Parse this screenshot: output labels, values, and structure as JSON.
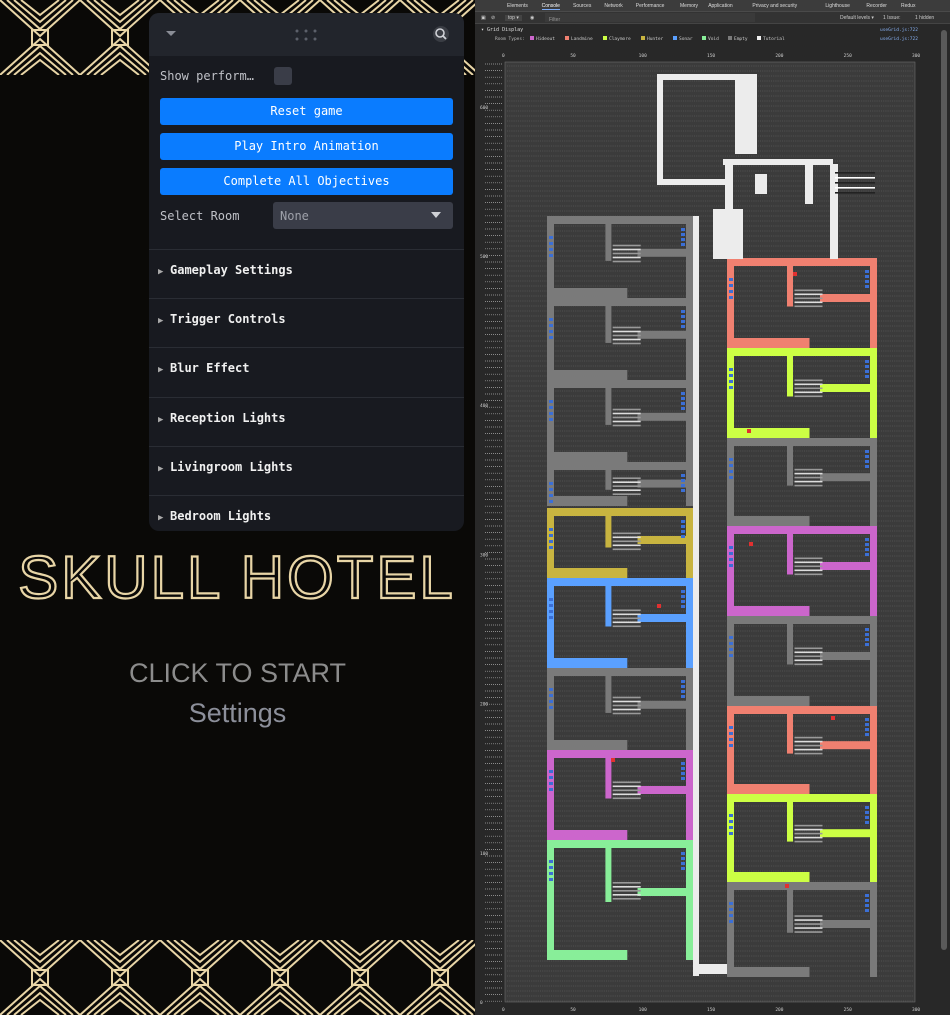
{
  "game": {
    "title": "SKULL HOTEL",
    "click_to_start": "CLICK TO START",
    "settings_link": "Settings"
  },
  "gui": {
    "show_performance_label": "Show perform…",
    "buttons": {
      "reset": "Reset game",
      "intro": "Play Intro Animation",
      "complete": "Complete All Objectives"
    },
    "select_room_label": "Select Room",
    "select_room_value": "None",
    "folders": [
      "Gameplay Settings",
      "Trigger Controls",
      "Blur Effect",
      "Reception Lights",
      "Livingroom Lights",
      "Bedroom Lights"
    ]
  },
  "devtools": {
    "tabs": [
      "Elements",
      "Console",
      "Sources",
      "Network",
      "Performance",
      "Memory",
      "Application",
      "Privacy and security",
      "Lighthouse",
      "Recorder",
      "Redux"
    ],
    "active_tab": "Console",
    "context": "top ▾",
    "filter_placeholder": "Filter",
    "levels": "Default levels ▾",
    "issues": "1 Issue:",
    "hidden": "1 hidden",
    "errors": "3",
    "warnings": "1",
    "group_title": "▾ Grid Display",
    "source_link": "useGrid.js:722",
    "room_types_label": "Room Types:",
    "legend": [
      {
        "name": "Hideout",
        "color": "#cc66cc"
      },
      {
        "name": "Landmine",
        "color": "#f08070"
      },
      {
        "name": "Claymore",
        "color": "#ccff44"
      },
      {
        "name": "Hunter",
        "color": "#c8b440"
      },
      {
        "name": "Sonar",
        "color": "#5aa0ff"
      },
      {
        "name": "Void",
        "color": "#88ee99"
      },
      {
        "name": "Empty",
        "color": "#7a7a7a"
      },
      {
        "name": "Tutorial",
        "color": "#f0f0f0"
      }
    ],
    "x_ticks": [
      "0",
      "50",
      "100",
      "150",
      "200",
      "250",
      "300"
    ],
    "y_ticks": [
      "0",
      "100",
      "200",
      "300",
      "400",
      "500",
      "600"
    ]
  }
}
